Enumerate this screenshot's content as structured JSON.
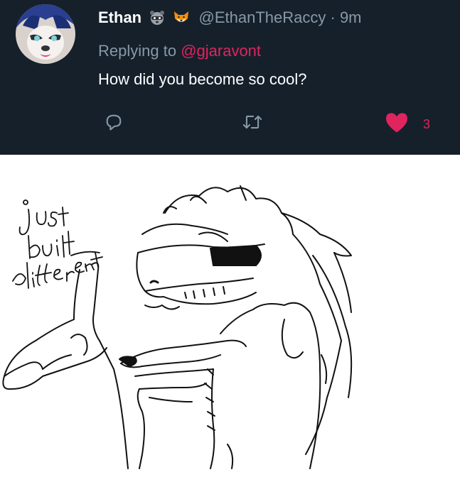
{
  "tweet": {
    "display_name": "Ethan",
    "name_emojis": [
      "raccoon-emoji",
      "fox-emoji"
    ],
    "handle": "@EthanTheRaccy",
    "separator": "·",
    "time": "9m",
    "replying_prefix": "Replying to ",
    "replying_to": "@gjaravont",
    "text": "How did you become so cool?",
    "like_count": "3",
    "liked": true,
    "colors": {
      "background": "#15202b",
      "secondary_text": "#8899a6",
      "accent_pink": "#e0245e"
    }
  },
  "actions": {
    "reply_icon": "reply-icon",
    "retweet_icon": "retweet-icon",
    "like_icon": "heart-icon"
  },
  "drawing": {
    "handwritten_text": "just built different"
  }
}
